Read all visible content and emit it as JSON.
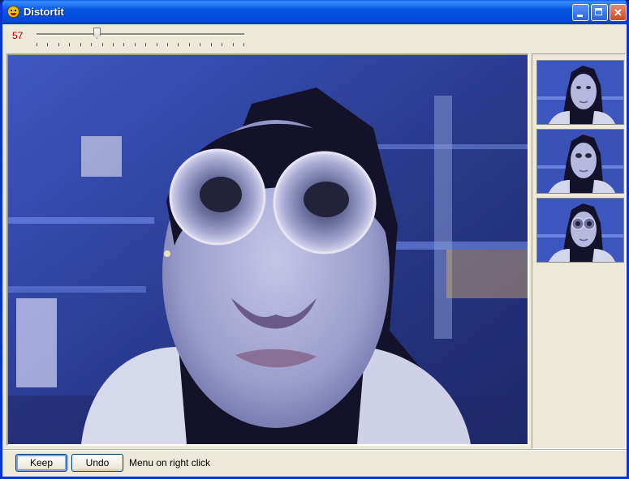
{
  "window": {
    "title": "Distortit"
  },
  "toolbar": {
    "zoom_value": "57",
    "slider_level": 0.29,
    "tick_count": 20
  },
  "buttons": {
    "keep": "Keep",
    "undo": "Undo"
  },
  "status": {
    "hint": "Menu on right click"
  },
  "thumbnails": [
    {
      "distortion": "none"
    },
    {
      "distortion": "slight"
    },
    {
      "distortion": "eyes"
    }
  ]
}
